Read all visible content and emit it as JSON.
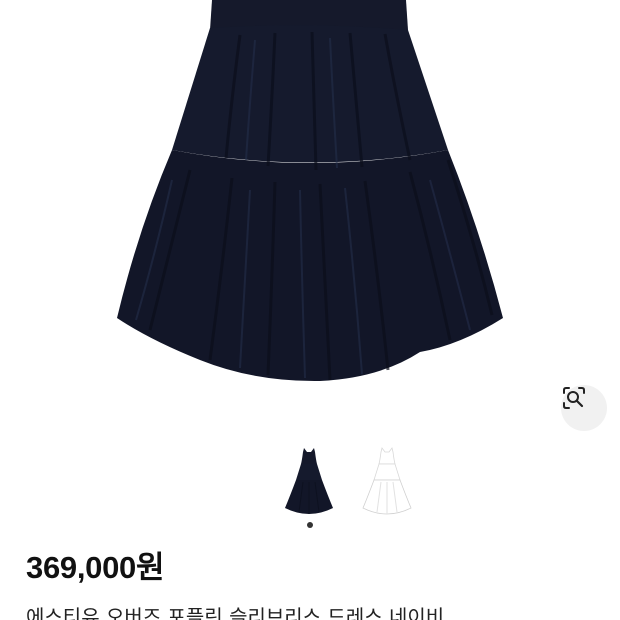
{
  "product": {
    "price": "369,000원",
    "title": "에스티유 오버즈 포플린 슬리브리스 드레스 네이비"
  },
  "gallery": {
    "images": [
      {
        "icon": "navy-dress-image",
        "color": "#15192b"
      }
    ],
    "thumbnails": [
      {
        "icon": "navy-dress-thumbnail",
        "color": "#15192b"
      },
      {
        "icon": "white-dress-thumbnail",
        "color": "#ffffff"
      }
    ],
    "current_page": 1,
    "page_count": 1
  },
  "lens": {
    "icon": "visual-search-icon"
  }
}
